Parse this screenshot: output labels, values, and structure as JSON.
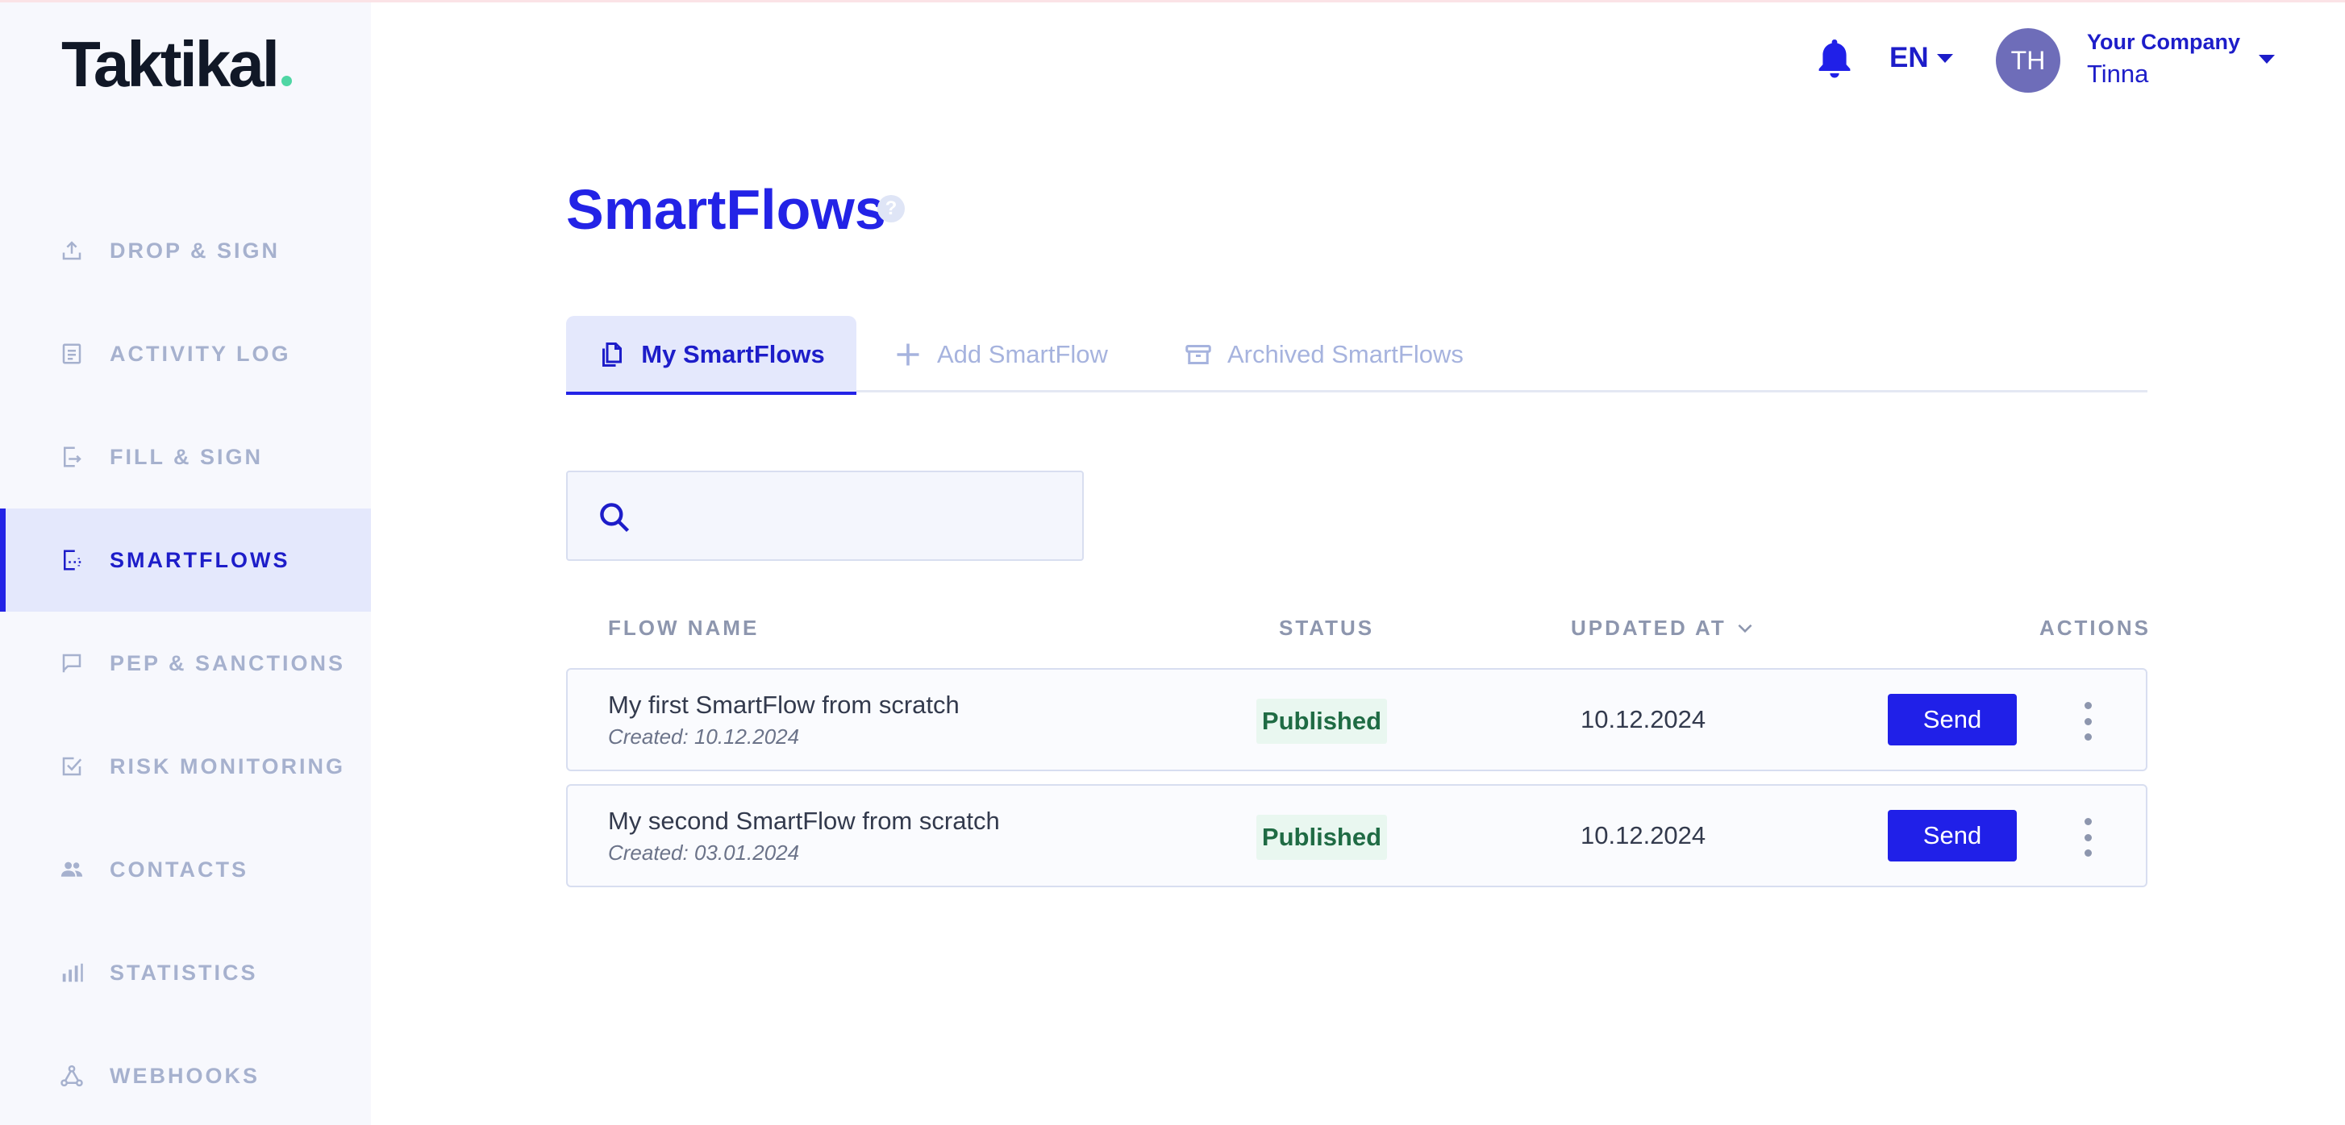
{
  "brand": {
    "name": "Taktikal",
    "dot_color": "#4fd6a4"
  },
  "sidebar": {
    "items": [
      {
        "label": "DROP & SIGN",
        "icon": "upload-icon",
        "active": false
      },
      {
        "label": "ACTIVITY LOG",
        "icon": "document-list-icon",
        "active": false
      },
      {
        "label": "FILL & SIGN",
        "icon": "fill-sign-icon",
        "active": false
      },
      {
        "label": "SMARTFLOWS",
        "icon": "smartflow-icon",
        "active": true
      },
      {
        "label": "PEP & SANCTIONS",
        "icon": "flag-icon",
        "active": false
      },
      {
        "label": "RISK MONITORING",
        "icon": "checkbox-icon",
        "active": false
      },
      {
        "label": "CONTACTS",
        "icon": "people-icon",
        "active": false
      },
      {
        "label": "STATISTICS",
        "icon": "bar-chart-icon",
        "active": false
      },
      {
        "label": "WEBHOOKS",
        "icon": "webhook-icon",
        "active": false
      }
    ]
  },
  "header": {
    "notification_icon": "bell-icon",
    "language": "EN",
    "avatar_initials": "TH",
    "company": "Your Company",
    "user": "Tinna"
  },
  "main": {
    "title": "SmartFlows",
    "help_icon": "?",
    "tabs": [
      {
        "label": "My SmartFlows",
        "icon": "documents-icon",
        "active": true
      },
      {
        "label": "Add SmartFlow",
        "icon": "plus-icon",
        "active": false
      },
      {
        "label": "Archived SmartFlows",
        "icon": "archive-icon",
        "active": false
      }
    ],
    "search": {
      "placeholder": "",
      "value": ""
    },
    "table": {
      "columns": {
        "name": "FLOW NAME",
        "status": "STATUS",
        "updated": "UPDATED AT",
        "actions": "ACTIONS"
      },
      "rows": [
        {
          "name": "My first SmartFlow from scratch",
          "created": "Created: 10.12.2024",
          "status": "Published",
          "updated": "10.12.2024",
          "action": "Send"
        },
        {
          "name": "My second SmartFlow from scratch",
          "created": "Created: 03.01.2024",
          "status": "Published",
          "updated": "10.12.2024",
          "action": "Send"
        }
      ]
    }
  },
  "colors": {
    "accent": "#2323e6",
    "sidebar_bg": "#f7f8fd",
    "sidebar_active_bg": "#e4e8fc",
    "muted_nav": "#a6b1ce",
    "published_bg": "#e9f7f0",
    "published_text": "#1f6b44"
  }
}
